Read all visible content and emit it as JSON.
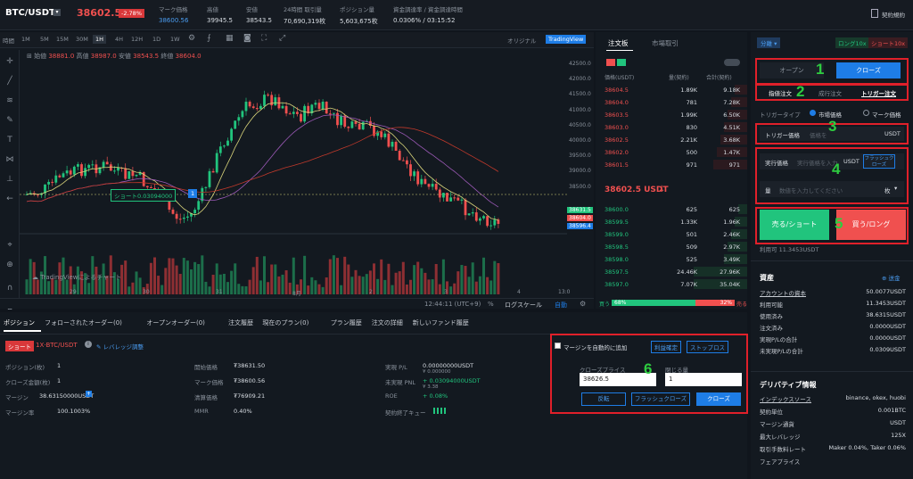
{
  "header": {
    "pair": "BTC/USDT",
    "price": "38602.5",
    "change": "-2.78%",
    "mark_label": "マーク価格",
    "mark_value": "38600.56",
    "high_label": "高値",
    "high_value": "39945.5",
    "low_label": "安値",
    "low_value": "38543.5",
    "vol_label": "24時間 取引量",
    "vol_value": "70,690,319枚",
    "pos_label": "ポジション量",
    "pos_value": "5,603,675枚",
    "funding_label": "資金調達率 / 資金調達時間",
    "funding_value": "0.0306% / 03:15:52",
    "agreement": "契約規約"
  },
  "chart": {
    "timeframe_label": "時間",
    "timeframes": [
      "1M",
      "5M",
      "15M",
      "30M",
      "1H",
      "4H",
      "12H",
      "1D",
      "1W"
    ],
    "views": [
      "オリジナル",
      "TradingView"
    ],
    "ohlc": {
      "o_label": "始値",
      "o": "38881.0",
      "h_label": "高値",
      "h": "38987.0",
      "l_label": "安値",
      "l": "38543.5",
      "c_label": "終値",
      "c": "38604.0"
    },
    "short_label": "ショート0.03094000",
    "short_count": "1",
    "yaxis": [
      "42500.0",
      "42000.0",
      "41500.0",
      "41000.0",
      "40500.0",
      "40000.0",
      "39500.0",
      "39000.0",
      "38500.0"
    ],
    "price_tags": [
      "38631.5",
      "38604.0",
      "38596.4"
    ],
    "xaxis": [
      "29",
      "30",
      "31",
      "8月",
      "2",
      "3",
      "4",
      "13:0"
    ],
    "clock": "12:44:11 (UTC+9)",
    "percent": "%",
    "log": "ログスケール",
    "auto": "自動",
    "watermark": "TradingViewによるチャート"
  },
  "orderbook": {
    "tabs": [
      "注文板",
      "市場取引"
    ],
    "headers": [
      "価格(USDT)",
      "量(契約)",
      "合計(契約)"
    ],
    "asks": [
      [
        "38604.5",
        "1.89K",
        "9.18K"
      ],
      [
        "38604.0",
        "781",
        "7.28K"
      ],
      [
        "38603.5",
        "1.99K",
        "6.50K"
      ],
      [
        "38603.0",
        "830",
        "4.51K"
      ],
      [
        "38602.5",
        "2.21K",
        "3.68K"
      ],
      [
        "38602.0",
        "500",
        "1.47K"
      ],
      [
        "38601.5",
        "971",
        "971"
      ]
    ],
    "last": "38602.5 USDT",
    "last_arrow": "↓",
    "bids": [
      [
        "38600.0",
        "625",
        "625"
      ],
      [
        "38599.5",
        "1.33K",
        "1.96K"
      ],
      [
        "38599.0",
        "501",
        "2.46K"
      ],
      [
        "38598.5",
        "509",
        "2.97K"
      ],
      [
        "38598.0",
        "525",
        "3.49K"
      ],
      [
        "38597.5",
        "24.46K",
        "27.96K"
      ],
      [
        "38597.0",
        "7.07K",
        "35.04K"
      ]
    ],
    "buy_label": "買う",
    "buy_pct": "68%",
    "sell_pct": "32%",
    "sell_label": "売る"
  },
  "panel": {
    "margin_mode": "分離",
    "long_label": "ロング10x",
    "short_label": "ショート10x",
    "open": "オープン",
    "close": "クローズ",
    "order_types": [
      "指値注文",
      "成行注文",
      "トリガー注文"
    ],
    "trigger_type": "トリガータイプ",
    "market_price": "市場価格",
    "mark_price": "マーク価格",
    "trigger_price": "トリガー価格",
    "price_placeholder": "価格を",
    "usdt": "USDT",
    "exec_price": "実行価格",
    "exec_placeholder": "実行価格を入力",
    "flash_close": "フラッシュクローズ",
    "qty_label": "量",
    "qty_placeholder": "数値を入力してください",
    "qty_unit": "枚",
    "sell_btn": "売る/ショート",
    "buy_btn": "買う/ロング",
    "available": "利用可 11.3453USDT",
    "assets_title": "資産",
    "transfer": "送金",
    "assets": [
      [
        "アカウントの資本",
        "50.0077USDT"
      ],
      [
        "利用可能",
        "11.3453USDT"
      ],
      [
        "使用済み",
        "38.6315USDT"
      ],
      [
        "注文済み",
        "0.0000USDT"
      ],
      [
        "実現P/Lの合計",
        "0.0000USDT"
      ],
      [
        "未実現P/Lの合計",
        "0.0309USDT"
      ]
    ],
    "deriv_title": "デリバティブ情報",
    "deriv": [
      [
        "インデックスソース",
        "binance, okex, huobi"
      ],
      [
        "契約単位",
        "0.001BTC"
      ],
      [
        "マージン通貨",
        "USDT"
      ],
      [
        "最大レバレッジ",
        "125X"
      ],
      [
        "取引手数料レート",
        "Maker 0.04%, Taker 0.06%"
      ],
      [
        "フェアプライス",
        ""
      ]
    ]
  },
  "positions": {
    "tabs": [
      "ポジション",
      "フォローされたオーダー(0)",
      "オープンオーダー(0)",
      "注文履歴",
      "現在のプラン(0)",
      "プラン履歴",
      "注文の詳細",
      "新しいファンド履歴"
    ],
    "tag": "ショート",
    "pair": "1X·BTC/USDT",
    "leverage": "レバレッジ調整",
    "fields": [
      [
        "ポジション(枚)",
        "1"
      ],
      [
        "クローズ金額(枚)",
        "1"
      ],
      [
        "マージン",
        "38.63150000USDT"
      ],
      [
        "マージン率",
        "100.1003%"
      ]
    ],
    "fields2": [
      [
        "開始価格",
        "₮38631.50"
      ],
      [
        "マーク価格",
        "₮38600.56"
      ],
      [
        "清算価格",
        "₮76909.21"
      ],
      [
        "MMR",
        "0.40%"
      ]
    ],
    "fields3": [
      [
        "実現 P/L",
        "0.00000000USDT"
      ],
      [
        "未実現 PNL",
        "+ 0.03094000USDT"
      ],
      [
        "ROE",
        "+ 0.08%"
      ],
      [
        "契約終了キュー",
        ""
      ]
    ],
    "pl_sub": "¥ 0.000000",
    "pnl_sub": "¥ 3.38",
    "auto_margin": "マージンを自動的に追加",
    "tp_sl": "利益確定",
    "stop_loss": "ストップロス",
    "close_price_label": "クローズプライス",
    "close_qty_label": "閉じる量",
    "close_price": "38626.5",
    "close_qty": "1",
    "reverse": "反転",
    "flash_close": "フラッシュクローズ",
    "close_btn": "クローズ"
  },
  "annotations": [
    "1",
    "2",
    "3",
    "4",
    "5",
    "6"
  ],
  "colors": {
    "accent": "#1e7de6",
    "green": "#21c47d",
    "red": "#f0504f",
    "annotation": "#e0202a"
  }
}
